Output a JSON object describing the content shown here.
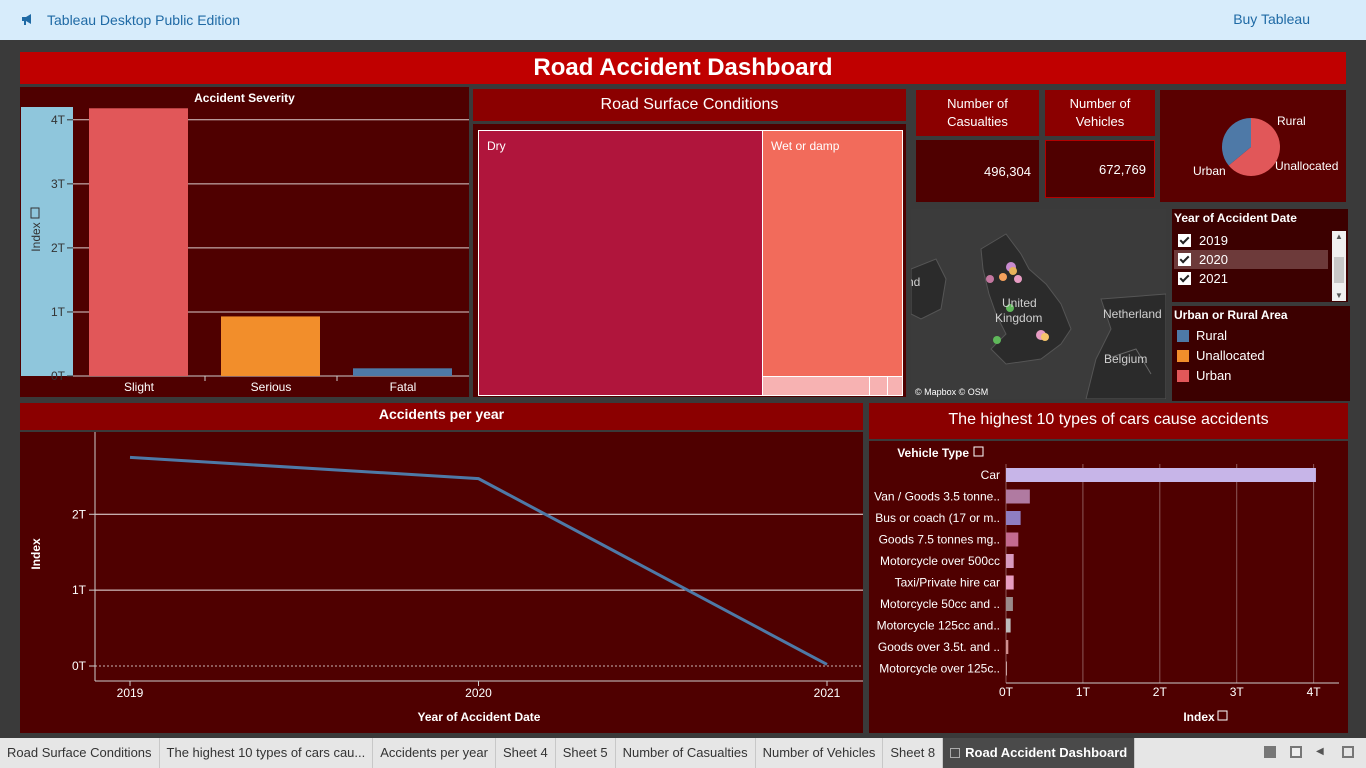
{
  "topbar": {
    "app_title": "Tableau Desktop Public Edition",
    "buy_label": "Buy Tableau",
    "icon": "megaphone-icon"
  },
  "dashboard": {
    "title": "Road Accident Dashboard"
  },
  "severity": {
    "title": "Accident Severity",
    "ylabel": "Index",
    "ticks": [
      "0T",
      "1T",
      "2T",
      "3T",
      "4T"
    ]
  },
  "road_surface": {
    "title": "Road Surface Conditions",
    "cells": [
      "Dry",
      "Wet or damp"
    ]
  },
  "kpis": {
    "casualties_label": "Number of Casualties",
    "casualties_value": "496,304",
    "vehicles_label": "Number of Vehicles",
    "vehicles_value": "672,769"
  },
  "pie": {
    "labels": {
      "rural": "Rural",
      "urban": "Urban",
      "unallocated": "Unallocated"
    }
  },
  "map": {
    "labels": {
      "uk1": "United",
      "uk2": "Kingdom",
      "nl": "Netherland",
      "be": "Belgium",
      "ireland": "nd"
    },
    "credit": "© Mapbox © OSM"
  },
  "year_filter": {
    "title": "Year of Accident Date",
    "options": [
      {
        "label": "2019",
        "checked": true
      },
      {
        "label": "2020",
        "checked": true
      },
      {
        "label": "2021",
        "checked": true
      }
    ]
  },
  "urban_legend": {
    "title": "Urban or Rural Area",
    "items": [
      {
        "label": "Rural",
        "color": "#4e79a7"
      },
      {
        "label": "Unallocated",
        "color": "#f28e2b"
      },
      {
        "label": "Urban",
        "color": "#e15759"
      }
    ]
  },
  "accidents_per_year": {
    "title": "Accidents per year",
    "ylabel": "Index",
    "xlabel": "Year of Accident Date"
  },
  "top10": {
    "title": "The highest 10 types of cars cause accidents",
    "row_header": "Vehicle Type",
    "xlabel": "Index"
  },
  "tabs": [
    "Road Surface Conditions",
    "The highest 10 types of cars cau...",
    "Accidents per year",
    "Sheet 4",
    "Sheet 5",
    "Number of Casualties",
    "Number of Vehicles",
    "Sheet 8",
    "Road Accident Dashboard"
  ],
  "colors": {
    "header": "#c00000",
    "panel": "#4f0000",
    "titlebar": "#8b0000"
  },
  "chart_data": [
    {
      "type": "bar",
      "title": "Accident Severity",
      "ylabel": "Index",
      "categories": [
        "Slight",
        "Serious",
        "Fatal"
      ],
      "values": [
        4.18,
        0.93,
        0.12
      ],
      "colors": [
        "#e15759",
        "#f28e2b",
        "#4e79a7"
      ],
      "ylim": [
        0,
        4.2
      ],
      "tick_labels": [
        "0T",
        "1T",
        "2T",
        "3T",
        "4T"
      ]
    },
    {
      "type": "heatmap",
      "title": "Road Surface Conditions",
      "categories": [
        "Dry",
        "Wet or damp"
      ],
      "colors": [
        "#b0153c",
        "#f26b5b"
      ]
    },
    {
      "type": "pie",
      "categories": [
        "Urban",
        "Rural",
        "Unallocated"
      ],
      "values": [
        0.64,
        0.36,
        0.0
      ],
      "colors": [
        "#e15759",
        "#4e79a7",
        "#f28e2b"
      ]
    },
    {
      "type": "line",
      "title": "Accidents per year",
      "xlabel": "Year of Accident Date",
      "ylabel": "Index",
      "x": [
        "2019",
        "2020",
        "2021"
      ],
      "y": [
        2.75,
        2.47,
        0.02
      ],
      "ylim": [
        0,
        2.9
      ],
      "tick_labels": [
        "0T",
        "1T",
        "2T"
      ]
    },
    {
      "type": "bar",
      "title": "The highest 10 types of cars cause accidents",
      "orientation": "horizontal",
      "xlabel": "Index",
      "categories": [
        "Car",
        "Van / Goods 3.5 tonne..",
        "Bus or coach (17 or m..",
        "Goods 7.5 tonnes mg..",
        "Motorcycle over 500cc",
        "Taxi/Private hire car",
        "Motorcycle 50cc and ..",
        "Motorcycle 125cc and..",
        "Goods over 3.5t. and ..",
        "Motorcycle over 125c.."
      ],
      "values": [
        4.03,
        0.31,
        0.19,
        0.16,
        0.1,
        0.1,
        0.09,
        0.06,
        0.03,
        0.01
      ],
      "colors": [
        "#c7b5e8",
        "#b07aa1",
        "#8f7ec2",
        "#c46a8f",
        "#d89abf",
        "#e89cc0",
        "#9a8a8a",
        "#bdbdbd",
        "#d08f8f",
        "#c9a3a3"
      ],
      "xlim": [
        0,
        4.2
      ],
      "tick_labels": [
        "0T",
        "1T",
        "2T",
        "3T",
        "4T"
      ]
    }
  ]
}
